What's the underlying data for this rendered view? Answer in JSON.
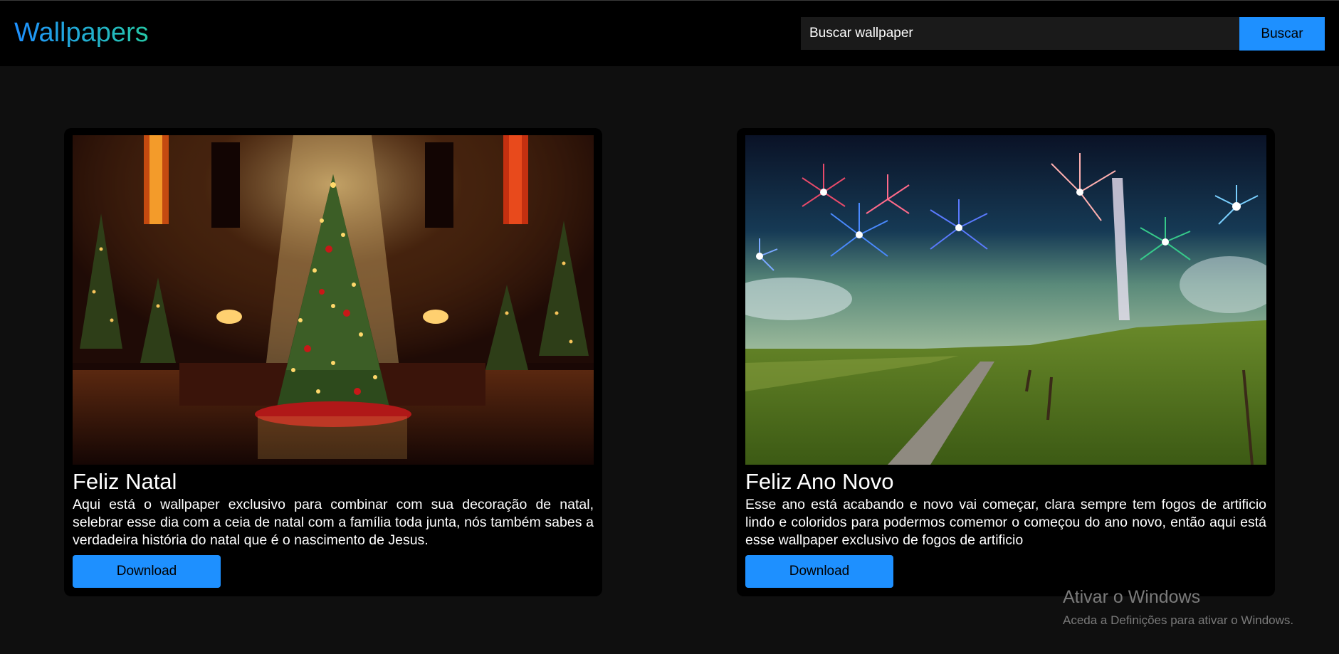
{
  "header": {
    "logo": "Wallpapers",
    "search_placeholder": "Buscar wallpaper",
    "search_button": "Buscar"
  },
  "cards": [
    {
      "image_alt": "christmas-tree-image",
      "title": "Feliz Natal",
      "text": "Aqui está o wallpaper exclusivo para combinar com sua decoração de natal, selebrar esse dia com a ceia de natal com a família toda junta, nós também sabes a verdadeira história do natal que é o nascimento de Jesus.",
      "button": "Download"
    },
    {
      "image_alt": "fireworks-landscape-image",
      "title": "Feliz Ano Novo",
      "text": "Esse ano está acabando e novo vai começar, clara sempre tem fogos de artificio lindo e coloridos para podermos comemor o começou do ano novo, então aqui está esse wallpaper exclusivo de fogos de artificio",
      "button": "Download"
    }
  ],
  "watermark": {
    "title": "Ativar o Windows",
    "subtitle": "Aceda a Definições para ativar o Windows."
  },
  "colors": {
    "accent": "#1e90ff",
    "background": "#0f0f0f",
    "header": "#000000",
    "card": "#000000"
  }
}
